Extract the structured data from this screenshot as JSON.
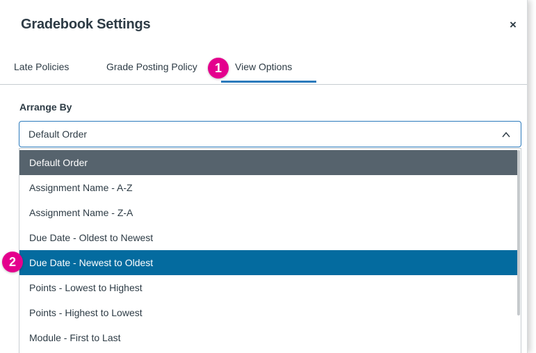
{
  "dialog": {
    "title": "Gradebook Settings",
    "close_label": "×"
  },
  "tabs": [
    {
      "label": "Late Policies",
      "active": false
    },
    {
      "label": "Grade Posting Policy",
      "active": false
    },
    {
      "label": "View Options",
      "active": true
    }
  ],
  "arrange_by": {
    "label": "Arrange By",
    "value": "Default Order",
    "expanded": true,
    "options": [
      {
        "label": "Default Order",
        "state": "selected"
      },
      {
        "label": "Assignment Name - A-Z",
        "state": "normal"
      },
      {
        "label": "Assignment Name - Z-A",
        "state": "normal"
      },
      {
        "label": "Due Date - Oldest to Newest",
        "state": "normal"
      },
      {
        "label": "Due Date - Newest to Oldest",
        "state": "highlighted"
      },
      {
        "label": "Points - Lowest to Highest",
        "state": "normal"
      },
      {
        "label": "Points - Highest to Lowest",
        "state": "normal"
      },
      {
        "label": "Module - First to Last",
        "state": "normal"
      }
    ]
  },
  "callouts": [
    {
      "number": "1"
    },
    {
      "number": "2"
    }
  ],
  "colors": {
    "accent": "#2b7abc",
    "selected_option_bg": "#56636d",
    "highlighted_option_bg": "#046b9f",
    "callout_bg": "#e4008d",
    "text": "#2d3b45"
  },
  "icons": {
    "close": "close-icon",
    "select_toggle": "chevron-up-icon"
  }
}
